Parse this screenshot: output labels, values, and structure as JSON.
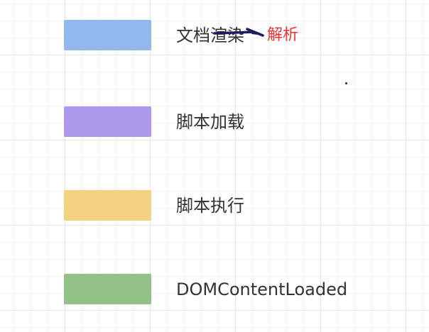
{
  "legend": {
    "items": [
      {
        "label": "文档渲染",
        "color": "#93b8ec"
      },
      {
        "label": "脚本加载",
        "color": "#ae98ec"
      },
      {
        "label": "脚本执行",
        "color": "#f2d382"
      },
      {
        "label": "DOMContentLoaded",
        "color": "#92c288"
      }
    ]
  },
  "annotation": {
    "text": "解析",
    "color": "#ee3333",
    "stroke_color": "#1d1a5e"
  }
}
